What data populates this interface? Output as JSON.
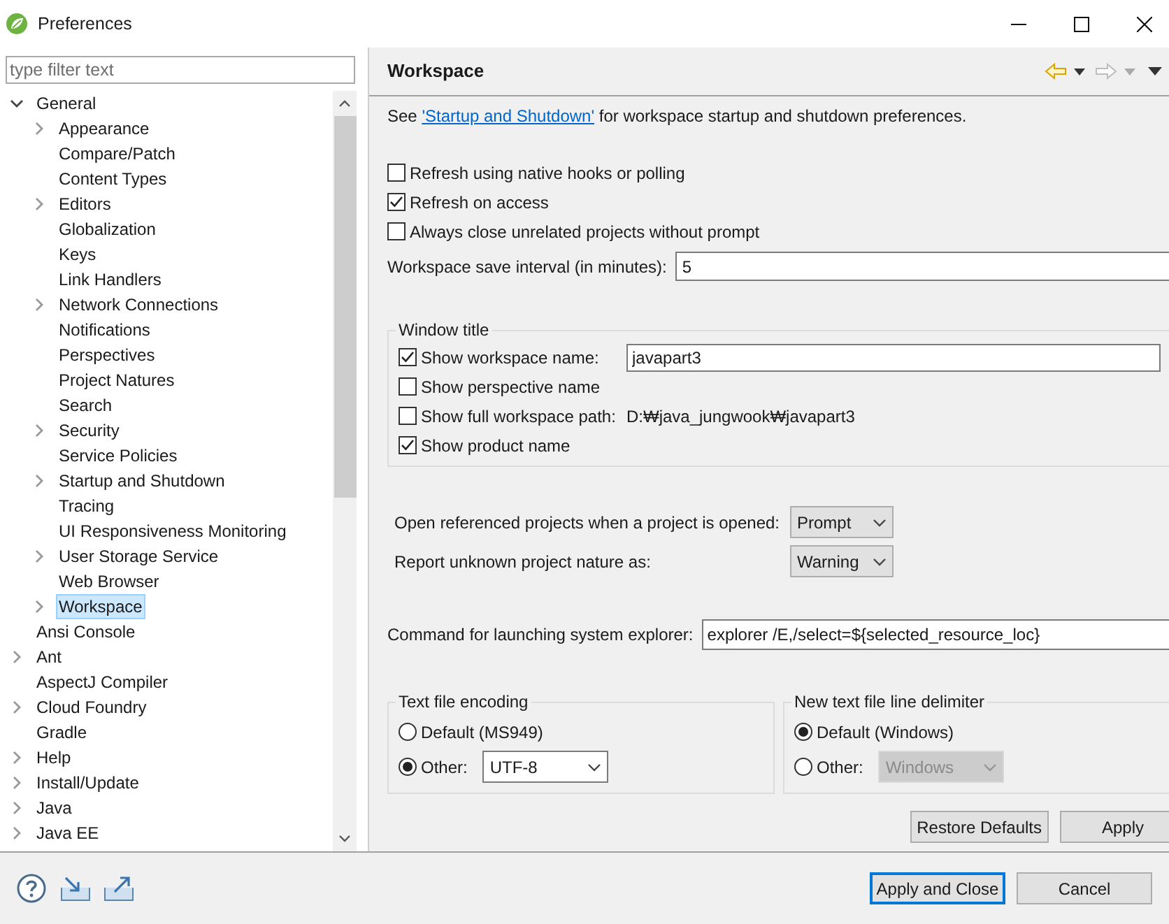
{
  "window": {
    "title": "Preferences"
  },
  "filter": {
    "placeholder": "type filter text"
  },
  "tree": [
    {
      "label": "General",
      "expanded": true,
      "selected": false,
      "children": [
        {
          "label": "Appearance",
          "expanded": false,
          "selected": false
        },
        {
          "label": "Compare/Patch",
          "selected": false
        },
        {
          "label": "Content Types",
          "selected": false
        },
        {
          "label": "Editors",
          "expanded": false,
          "selected": false
        },
        {
          "label": "Globalization",
          "selected": false
        },
        {
          "label": "Keys",
          "selected": false
        },
        {
          "label": "Link Handlers",
          "selected": false
        },
        {
          "label": "Network Connections",
          "expanded": false,
          "selected": false
        },
        {
          "label": "Notifications",
          "selected": false
        },
        {
          "label": "Perspectives",
          "selected": false
        },
        {
          "label": "Project Natures",
          "selected": false
        },
        {
          "label": "Search",
          "selected": false
        },
        {
          "label": "Security",
          "expanded": false,
          "selected": false
        },
        {
          "label": "Service Policies",
          "selected": false
        },
        {
          "label": "Startup and Shutdown",
          "expanded": false,
          "selected": false
        },
        {
          "label": "Tracing",
          "selected": false
        },
        {
          "label": "UI Responsiveness Monitoring",
          "selected": false
        },
        {
          "label": "User Storage Service",
          "expanded": false,
          "selected": false
        },
        {
          "label": "Web Browser",
          "selected": false
        },
        {
          "label": "Workspace",
          "expanded": false,
          "selected": true
        }
      ]
    },
    {
      "label": "Ansi Console",
      "selected": false
    },
    {
      "label": "Ant",
      "expanded": false,
      "selected": false
    },
    {
      "label": "AspectJ Compiler",
      "selected": false
    },
    {
      "label": "Cloud Foundry",
      "expanded": false,
      "selected": false
    },
    {
      "label": "Gradle",
      "selected": false
    },
    {
      "label": "Help",
      "expanded": false,
      "selected": false
    },
    {
      "label": "Install/Update",
      "expanded": false,
      "selected": false
    },
    {
      "label": "Java",
      "expanded": false,
      "selected": false
    },
    {
      "label": "Java EE",
      "expanded": false,
      "selected": false
    }
  ],
  "page": {
    "title": "Workspace",
    "intro": {
      "before": "See ",
      "link": "'Startup and Shutdown'",
      "after": " for workspace startup and shutdown preferences."
    },
    "options": [
      {
        "label": "Refresh using native hooks or polling",
        "checked": false
      },
      {
        "label": "Refresh on access",
        "checked": true
      },
      {
        "label": "Always close unrelated projects without prompt",
        "checked": false
      }
    ],
    "save_interval": {
      "label": "Workspace save interval (in minutes):",
      "value": "5"
    },
    "window_title": {
      "legend": "Window title",
      "rows": [
        {
          "kind": "field",
          "label": "Show workspace name:",
          "checked": true,
          "value": "javapart3"
        },
        {
          "kind": "plain",
          "label": "Show perspective name",
          "checked": false
        },
        {
          "kind": "path",
          "label": "Show full workspace path:",
          "checked": false,
          "path": "D:₩java_jungwook₩javapart3"
        },
        {
          "kind": "plain",
          "label": "Show product name",
          "checked": true
        }
      ]
    },
    "selects": [
      {
        "label": "Open referenced projects when a project is opened:",
        "value": "Prompt"
      },
      {
        "label": "Report unknown project nature as:",
        "value": "Warning"
      }
    ],
    "explorer": {
      "label": "Command for launching system explorer:",
      "value": "explorer /E,/select=${selected_resource_loc}"
    },
    "encoding": {
      "legend": "Text file encoding",
      "options": [
        {
          "label": "Default (MS949)",
          "selected": false
        },
        {
          "label": "Other:",
          "selected": true,
          "dropdown": {
            "value": "UTF-8",
            "disabled": false
          }
        }
      ]
    },
    "delimiter": {
      "legend": "New text file line delimiter",
      "options": [
        {
          "label": "Default (Windows)",
          "selected": true
        },
        {
          "label": "Other:",
          "selected": false,
          "dropdown": {
            "value": "Windows",
            "disabled": true
          }
        }
      ]
    },
    "buttons": [
      "Restore Defaults",
      "Apply"
    ]
  },
  "dialog_buttons": [
    {
      "label": "Apply and Close",
      "default": true
    },
    {
      "label": "Cancel",
      "default": false
    }
  ]
}
